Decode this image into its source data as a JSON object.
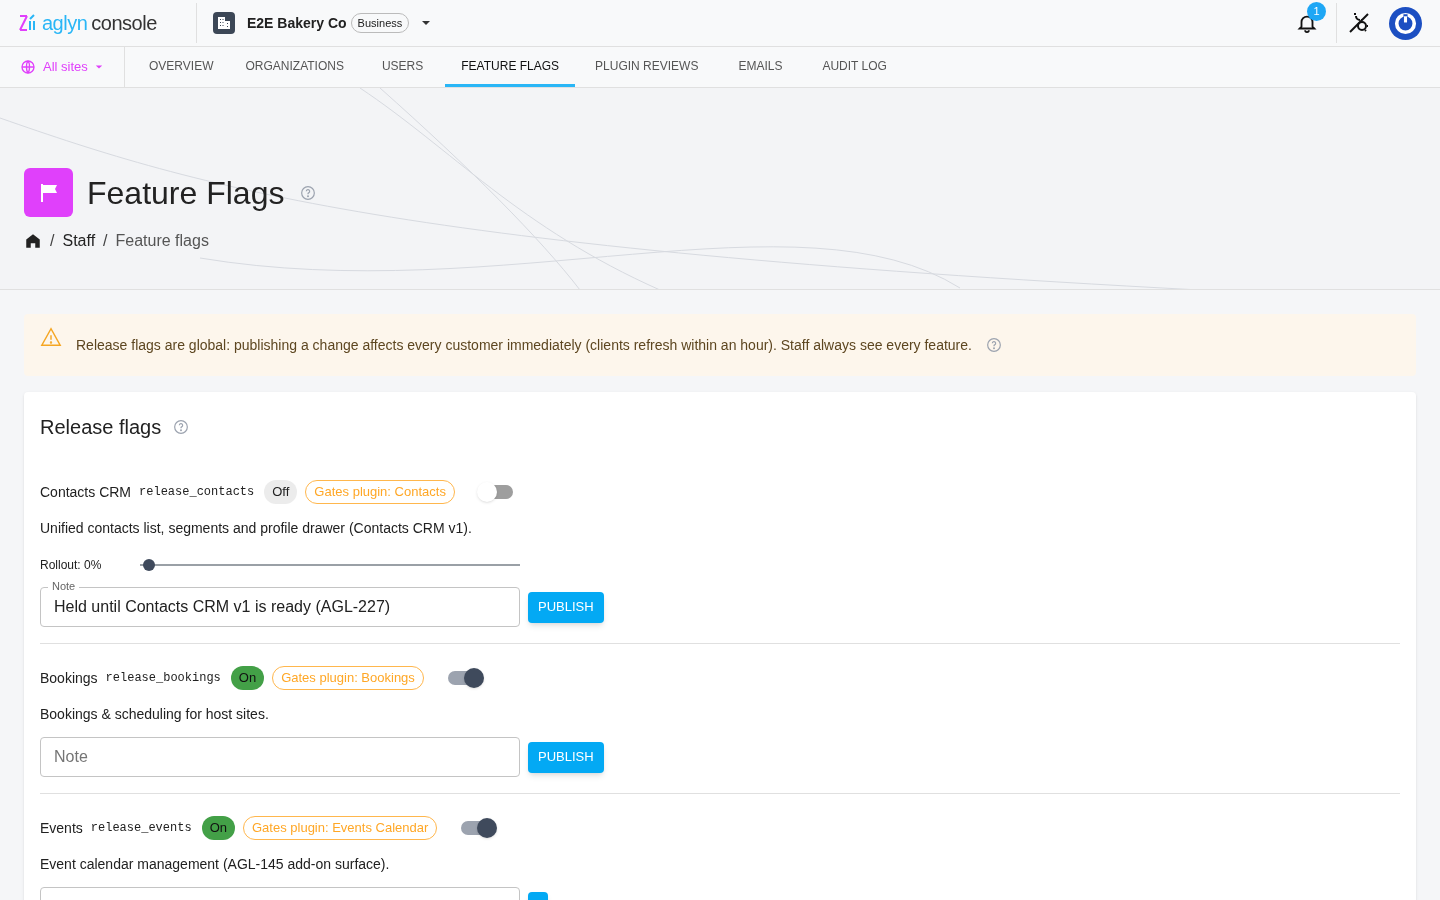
{
  "topbar": {
    "logo_brand": "aglyn",
    "logo_product": "console",
    "org_name": "E2E Bakery Co",
    "org_plan": "Business",
    "notification_count": "1"
  },
  "nav": {
    "site_picker": "All sites",
    "tabs": [
      {
        "label": "OVERVIEW",
        "selected": false
      },
      {
        "label": "ORGANIZATIONS",
        "selected": false
      },
      {
        "label": "USERS",
        "selected": false
      },
      {
        "label": "FEATURE FLAGS",
        "selected": true
      },
      {
        "label": "PLUGIN REVIEWS",
        "selected": false
      },
      {
        "label": "EMAILS",
        "selected": false
      },
      {
        "label": "AUDIT LOG",
        "selected": false
      }
    ]
  },
  "header": {
    "title": "Feature Flags",
    "breadcrumb_separator": "/",
    "breadcrumb": [
      "Staff",
      "Feature flags"
    ]
  },
  "alert": {
    "text": "Release flags are global: publishing a change affects every customer immediately (clients refresh within an hour). Staff always see every feature."
  },
  "section": {
    "title": "Release flags",
    "flags": [
      {
        "name": "Contacts CRM",
        "key": "release_contacts",
        "status": "Off",
        "on": false,
        "gate": "Gates plugin: Contacts",
        "description": "Unified contacts list, segments and profile drawer (Contacts CRM v1).",
        "rollout": {
          "label": "Rollout: 0%",
          "level": 0
        },
        "note": {
          "label": "Note",
          "value": "Held until Contacts CRM v1 is ready (AGL-227)"
        },
        "button": "PUBLISH"
      },
      {
        "name": "Bookings",
        "key": "release_bookings",
        "status": "On",
        "on": true,
        "gate": "Gates plugin: Bookings",
        "description": "Bookings & scheduling for host sites.",
        "note": {
          "placeholder": "Note"
        },
        "button": "PUBLISH"
      },
      {
        "name": "Events",
        "key": "release_events",
        "status": "On",
        "on": true,
        "gate": "Gates plugin: Events Calendar",
        "description": "Event calendar management (AGL-145 add-on surface)."
      }
    ]
  }
}
